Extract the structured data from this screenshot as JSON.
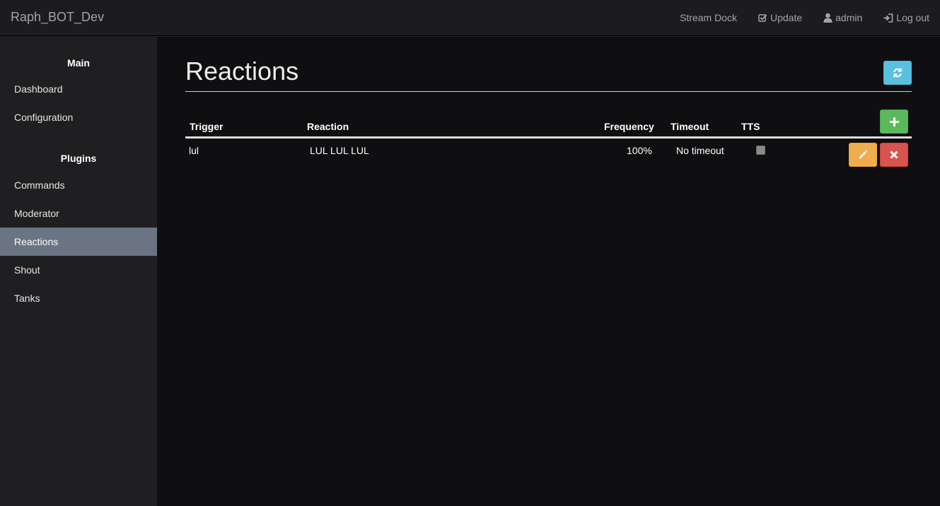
{
  "navbar": {
    "brand": "Raph_BOT_Dev",
    "links": [
      {
        "label": "Stream Dock",
        "icon": "none"
      },
      {
        "label": "Update",
        "icon": "check-square-icon"
      },
      {
        "label": "admin",
        "icon": "user-icon"
      },
      {
        "label": "Log out",
        "icon": "log-out-icon"
      }
    ]
  },
  "sidebar": {
    "main_heading": "Main",
    "main_items": [
      "Dashboard",
      "Configuration"
    ],
    "plugins_heading": "Plugins",
    "plugin_items": [
      "Commands",
      "Moderator",
      "Reactions",
      "Shout",
      "Tanks"
    ],
    "active_item": "Reactions"
  },
  "page": {
    "title": "Reactions",
    "refresh_icon": "refresh-icon",
    "add_icon": "plus-icon"
  },
  "table": {
    "columns": [
      "Trigger",
      "Reaction",
      "Frequency",
      "Timeout",
      "TTS"
    ],
    "rows": [
      {
        "trigger": "lul",
        "reaction": "LUL LUL LUL",
        "frequency": "100%",
        "timeout": "No timeout",
        "tts": false
      }
    ],
    "edit_icon": "pencil-icon",
    "delete_icon": "close-icon"
  },
  "colors": {
    "info": "#5bc0de",
    "success": "#5cb85c",
    "warning": "#f0ad4e",
    "danger": "#d9534f",
    "active_sidebar": "#6a7482"
  }
}
